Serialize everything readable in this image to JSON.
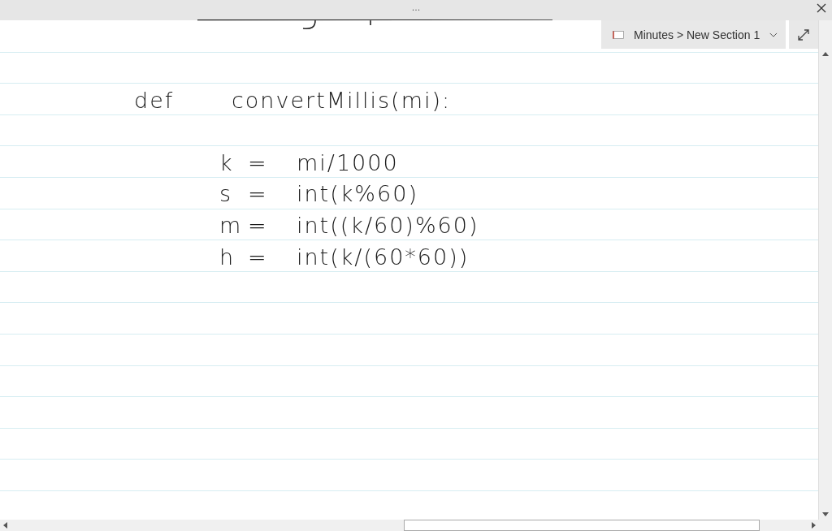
{
  "title_bar": {
    "more": "..."
  },
  "location": {
    "breadcrumb": "Minutes > New Section 1"
  },
  "definition": {
    "keyword": "def",
    "signature": "convertMillis(mi):"
  },
  "statements": [
    {
      "variable": "k",
      "operator": "=",
      "expression": "mi/1000"
    },
    {
      "variable": "s",
      "operator": "=",
      "expression": "int(k%60)"
    },
    {
      "variable": "m",
      "operator": "=",
      "expression": "int((k/60)%60)"
    },
    {
      "variable": "h",
      "operator": "=",
      "expression": "int(k/(60*60))"
    }
  ]
}
